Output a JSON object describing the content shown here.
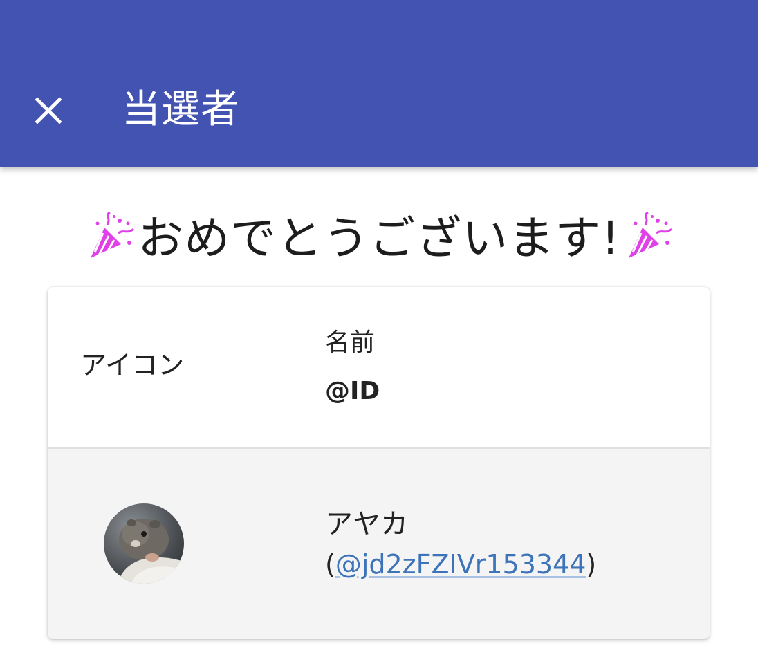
{
  "appbar": {
    "title": "当選者",
    "background_color": "#4253b1",
    "close_icon": "close-icon"
  },
  "congrats": {
    "text": "おめでとうございます!",
    "left_icon": "party-popper-icon",
    "right_icon": "party-popper-icon"
  },
  "table": {
    "headers": {
      "icon": "アイコン",
      "name": "名前",
      "id": "@ID"
    },
    "rows": [
      {
        "avatar": "hamster-avatar",
        "name": "アヤカ",
        "id_open": "(",
        "id_handle": "@jd2zFZIVr153344",
        "id_close": ")"
      }
    ]
  },
  "colors": {
    "link": "#3d73b8",
    "row_background": "#f4f4f4",
    "party_accent": "#e040e8"
  }
}
